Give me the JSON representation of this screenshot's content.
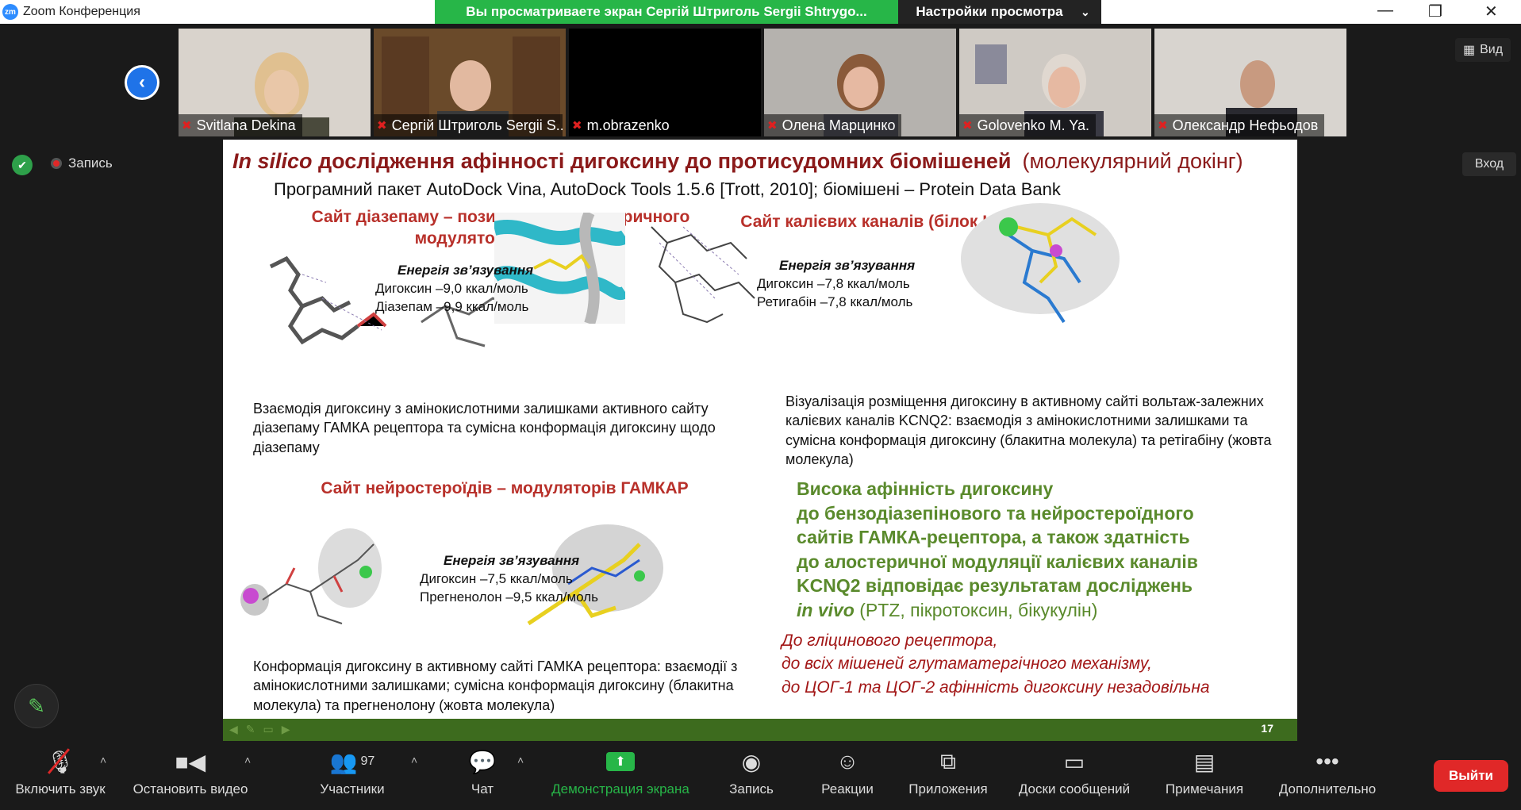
{
  "window": {
    "title": "Zoom Конференция",
    "logo": "zm",
    "share_notice": "Вы просматриваете экран Сергій Штриголь Sergii Shtrygo...",
    "view_settings": "Настройки просмотра"
  },
  "top_right": {
    "view_label": "Вид",
    "enter_label": "Вход"
  },
  "recording_label": "Запись",
  "participants": [
    {
      "name": "Svitlana Dekina"
    },
    {
      "name": "Сергій Штриголь Sergii S..."
    },
    {
      "name": "m.obrazenko"
    },
    {
      "name": "Олена Марцинко"
    },
    {
      "name": "Golovenko M. Ya."
    },
    {
      "name": "Олександр Нефьодов"
    }
  ],
  "slide": {
    "title_italic": "In silico",
    "title_rest": " дослідження афінності дигоксину до протисудомних біомішеней",
    "title_paren": "(молекулярний докінг)",
    "subtitle": "Програмний пакет AutoDock Vina, AutoDock Tools 1.5.6 [Trott, 2010]; біомішені – Protein Data Bank",
    "sec1_line1": "Сайт діазепаму – позитивного алостеричного",
    "sec1_line2": "модулятора ГАМКАР",
    "sec2": "Сайт калієвих каналів (білок KCNQ2)",
    "sec3": "Сайт нейростероїдів – модуляторів ГАМКАР",
    "energy_head": "Енергія зв’язування",
    "e1_a": "Дигоксин   –9,0 ккал/моль",
    "e1_b": "Діазепам   –9,9 ккал/моль",
    "e2_a": "Дигоксин   –7,8 ккал/моль",
    "e2_b": "Ретигабін   –7,8 ккал/моль",
    "e3_a": "Дигоксин   –7,5 ккал/моль",
    "e3_b": "Прегненолон –9,5 ккал/моль",
    "cap1": "Взаємодія дигоксину з амінокислотними залишками активного сайту діазепаму ГАМКА рецептора та сумісна конформація дигоксину щодо діазепаму",
    "cap2": "Візуалізація розміщення дигоксину в активному сайті вольтаж-залежних калієвих каналів KCNQ2: взаємодія з амінокислотними залишками та сумісна конформація дигоксину (блакитна молекула) та ретігабіну (жовта молекула)",
    "cap3": "Конформація дигоксину в активному сайті ГАМКА рецептора: взаємодії з амінокислотними залишками; сумісна конформація дигоксину (блакитна молекула) та прегненолону (жовта молекула)",
    "green_l1": "Висока афінність дигоксину",
    "green_l2": "до бензодіазепінового та нейростероїдного",
    "green_l3": "сайтів ГАМКА-рецептора, а також здатність",
    "green_l4": "до алостеричної модуляції калієвих каналів",
    "green_l5": "KCNQ2 відповідає результатам досліджень",
    "green_l6_italic": "in vivo",
    "green_l6_rest": " (PTZ, пікротоксин, бікукулін)",
    "red_l1": "До гліцинового рецептора,",
    "red_l2": "до всіх мішеней глутаматергічного механізму,",
    "red_l3": "до ЦОГ-1 та ЦОГ-2 афінність дигоксину незадовільна",
    "page_number": "17"
  },
  "toolbar": {
    "mute": "Включить звук",
    "video": "Остановить видео",
    "participants": "Участники",
    "participants_count": "97",
    "chat": "Чат",
    "share": "Демонстрация экрана",
    "record": "Запись",
    "reactions": "Реакции",
    "apps": "Приложения",
    "whiteboards": "Доски сообщений",
    "notes": "Примечания",
    "more": "Дополнительно",
    "exit": "Выйти"
  },
  "colors": {
    "share_green": "#27b648",
    "slide_green_bar": "#3d6b1e",
    "exit_red": "#e02828",
    "title_red": "#8b1a1a"
  }
}
